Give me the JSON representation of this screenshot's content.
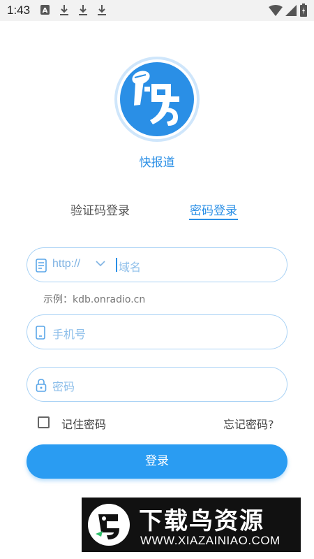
{
  "status_bar": {
    "time": "1:43",
    "icons": [
      "font-a-icon",
      "download-icon",
      "download-icon",
      "download-icon",
      "wifi-icon",
      "signal-icon",
      "battery-icon"
    ]
  },
  "app": {
    "logo_text": "快",
    "name": "快报道"
  },
  "tabs": [
    {
      "label": "验证码登录",
      "active": false
    },
    {
      "label": "密码登录",
      "active": true
    }
  ],
  "form": {
    "domain": {
      "protocol": "http://",
      "placeholder": "域名"
    },
    "example_hint": "示例：kdb.onradio.cn",
    "phone": {
      "placeholder": "手机号"
    },
    "password": {
      "placeholder": "密码"
    },
    "remember_label": "记住密码",
    "remember_checked": false,
    "forgot_label": "忘记密码?",
    "submit_label": "登录"
  },
  "watermark": {
    "title": "下载鸟资源",
    "url": "WWW.XIAZAINIAO.COM"
  },
  "colors": {
    "accent": "#2a8fe6",
    "button": "#2a9cf2",
    "field_border": "#a9d2f5"
  }
}
